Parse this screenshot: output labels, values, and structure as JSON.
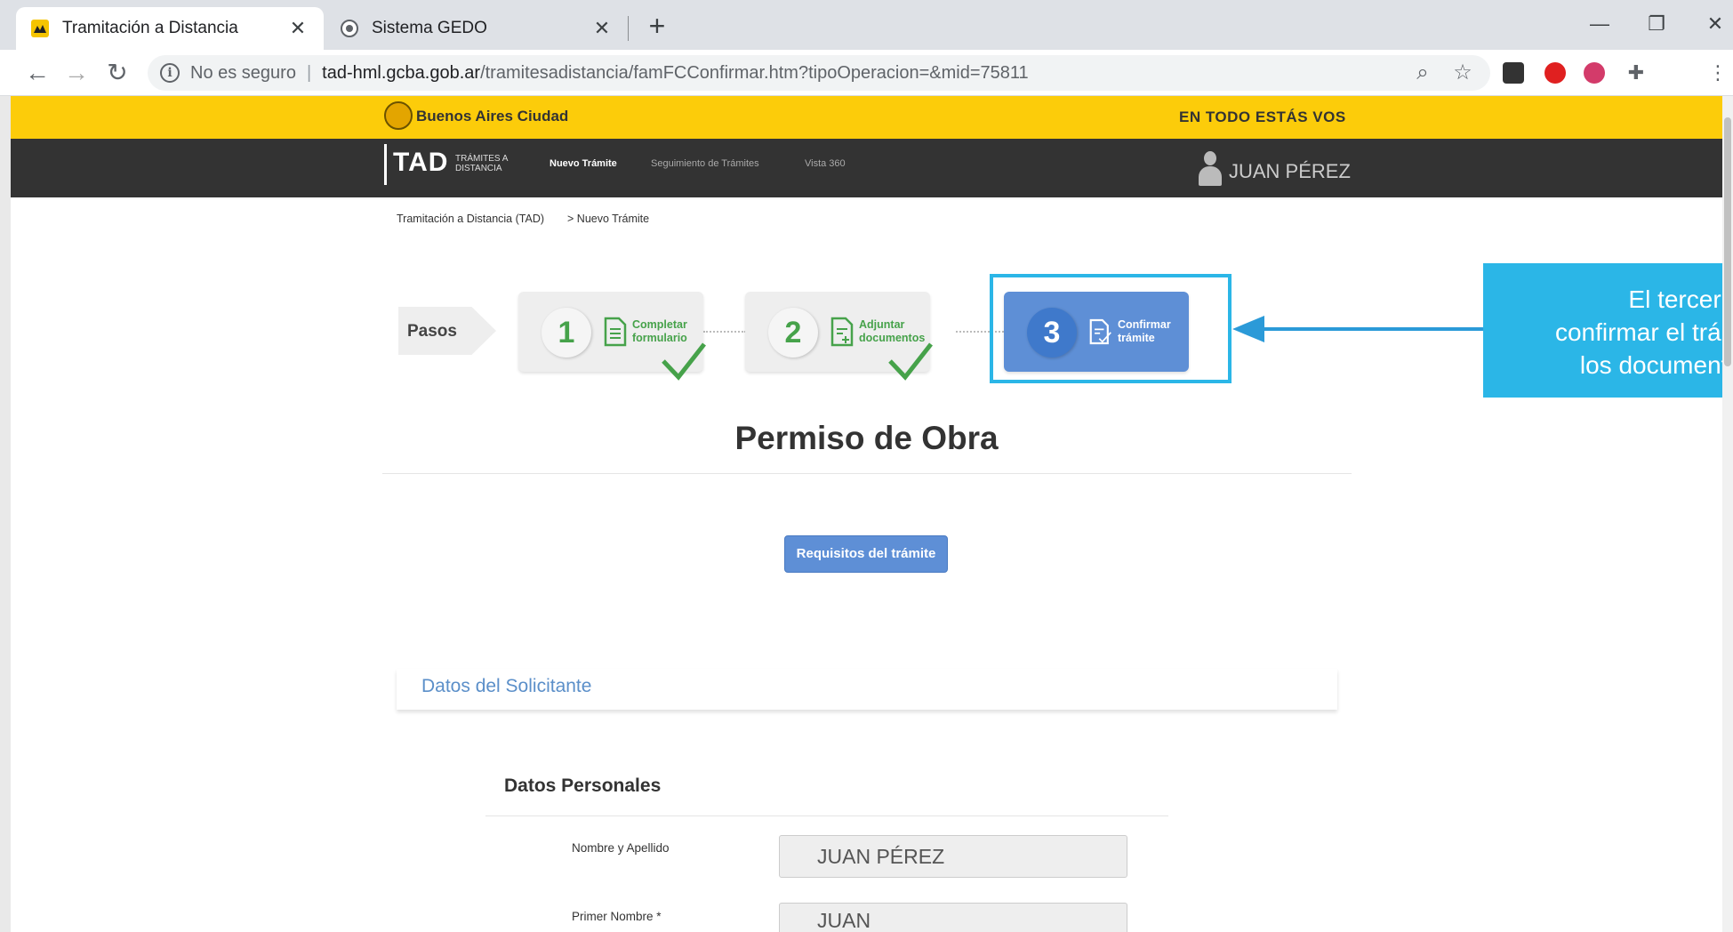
{
  "browser": {
    "tabs": [
      {
        "title": "Tramitación a Distancia",
        "active": true
      },
      {
        "title": "Sistema GEDO",
        "active": false
      }
    ],
    "close_glyph": "✕",
    "new_tab_glyph": "+",
    "security_label": "No es seguro",
    "url_host": "tad-hml.gcba.gob.ar",
    "url_path": "/tramitesadistancia/famFCConfirmar.htm?tipoOperacion=&mid=75811"
  },
  "site": {
    "brand": "Buenos Aires Ciudad",
    "tagline": "EN TODO ESTÁS VOS",
    "logo_text": "TAD",
    "logo_sub": "TRÁMITES A DISTANCIA",
    "nav": [
      "Nuevo Trámite",
      "Seguimiento de Trámites",
      "Vista 360"
    ],
    "user": "JUAN PÉREZ"
  },
  "breadcrumb": [
    "Tramitación a Distancia (TAD)",
    "> Nuevo Trámite"
  ],
  "steps": {
    "label": "Pasos",
    "items": [
      {
        "number": "1",
        "label": "Completar formulario",
        "status": "done"
      },
      {
        "number": "2",
        "label": "Adjuntar documentos",
        "status": "done"
      },
      {
        "number": "3",
        "label": "Confirmar trámite",
        "status": "current"
      }
    ]
  },
  "callout": {
    "lines": [
      "El tercer p",
      "confirmar el trám",
      "los documento"
    ]
  },
  "page": {
    "title": "Permiso de Obra",
    "requirements_button": "Requisitos del trámite",
    "section": "Datos del Solicitante",
    "subsection": "Datos Personales"
  },
  "form": {
    "fields": [
      {
        "label": "Nombre y Apellido",
        "value": "JUAN PÉREZ"
      },
      {
        "label": "Primer Nombre *",
        "value": "JUAN"
      }
    ]
  },
  "colors": {
    "yellow": "#fccc0a",
    "nav": "#333333",
    "step_done": "#46a24a",
    "step_current": "#5e8fd6",
    "callout": "#2bb6e7"
  }
}
